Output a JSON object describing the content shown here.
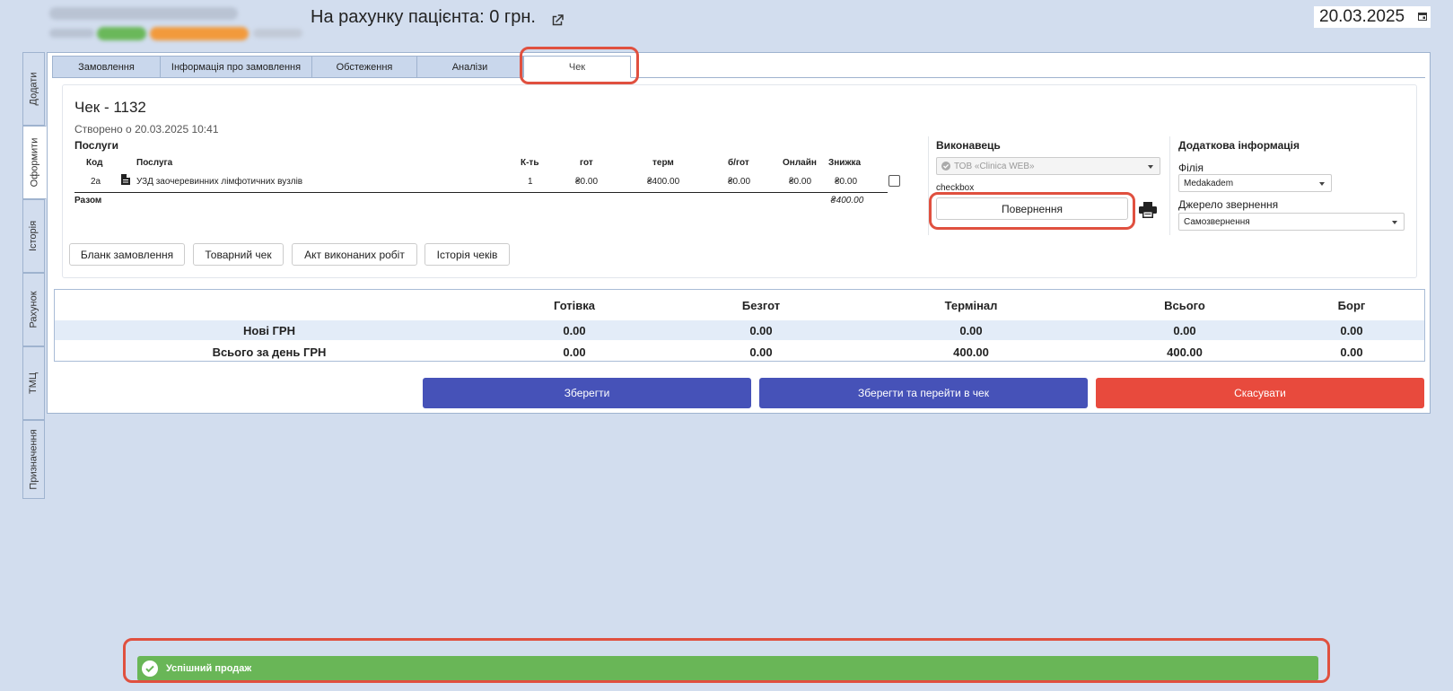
{
  "header": {
    "balance_text": "На рахунку пацієнта: 0 грн.",
    "date": "20.03.2025"
  },
  "side_tabs": [
    "Додати",
    "Оформити",
    "Історія",
    "Рахунок",
    "ТМЦ",
    "Призначення"
  ],
  "top_tabs": [
    "Замовлення",
    "Інформація про замовлення",
    "Обстеження",
    "Аналізи",
    "Чек"
  ],
  "check": {
    "title": "Чек - 1132",
    "created": "Створено о 20.03.2025 10:41",
    "services_label": "Послуги",
    "columns": [
      "Код",
      "Послуга",
      "К-ть",
      "гот",
      "терм",
      "б/гот",
      "Онлайн",
      "Знижка"
    ],
    "rows": [
      {
        "code": "2a",
        "service": "УЗД заочеревинних лімфотичних вузлів",
        "qty": "1",
        "cash": "₴0.00",
        "term": "₴400.00",
        "noncash": "₴0.00",
        "online": "₴0.00",
        "discount": "₴0.00"
      }
    ],
    "total_label": "Разом",
    "total_value": "₴400.00",
    "executor_label": "Виконавець",
    "executor_value": "ТОВ «Clinica WEB»",
    "checkbox_label": "checkbox",
    "return_button": "Повернення",
    "additional_label": "Додаткова інформація",
    "branch_label": "Філія",
    "branch_value": "Medakadem",
    "source_label": "Джерело звернення",
    "source_value": "Самозвернення",
    "action_buttons": [
      "Бланк замовлення",
      "Товарний чек",
      "Акт виконаних робіт",
      "Історія чеків"
    ]
  },
  "summary": {
    "headers": [
      "Готівка",
      "Безгот",
      "Термінал",
      "Всього",
      "Борг"
    ],
    "rows": [
      {
        "label": "Нові ГРН",
        "values": [
          "0.00",
          "0.00",
          "0.00",
          "0.00",
          "0.00"
        ]
      },
      {
        "label": "Всього за день ГРН",
        "values": [
          "0.00",
          "0.00",
          "400.00",
          "400.00",
          "0.00"
        ]
      }
    ]
  },
  "buttons": {
    "save": "Зберегти",
    "save_go": "Зберегти та перейти в чек",
    "cancel": "Скасувати"
  },
  "colors": {
    "primary": "#4652b8",
    "danger": "#e84a3d",
    "success": "#69b657",
    "highlight": "#e0503f"
  },
  "toast": {
    "message": "Успішний продаж"
  }
}
